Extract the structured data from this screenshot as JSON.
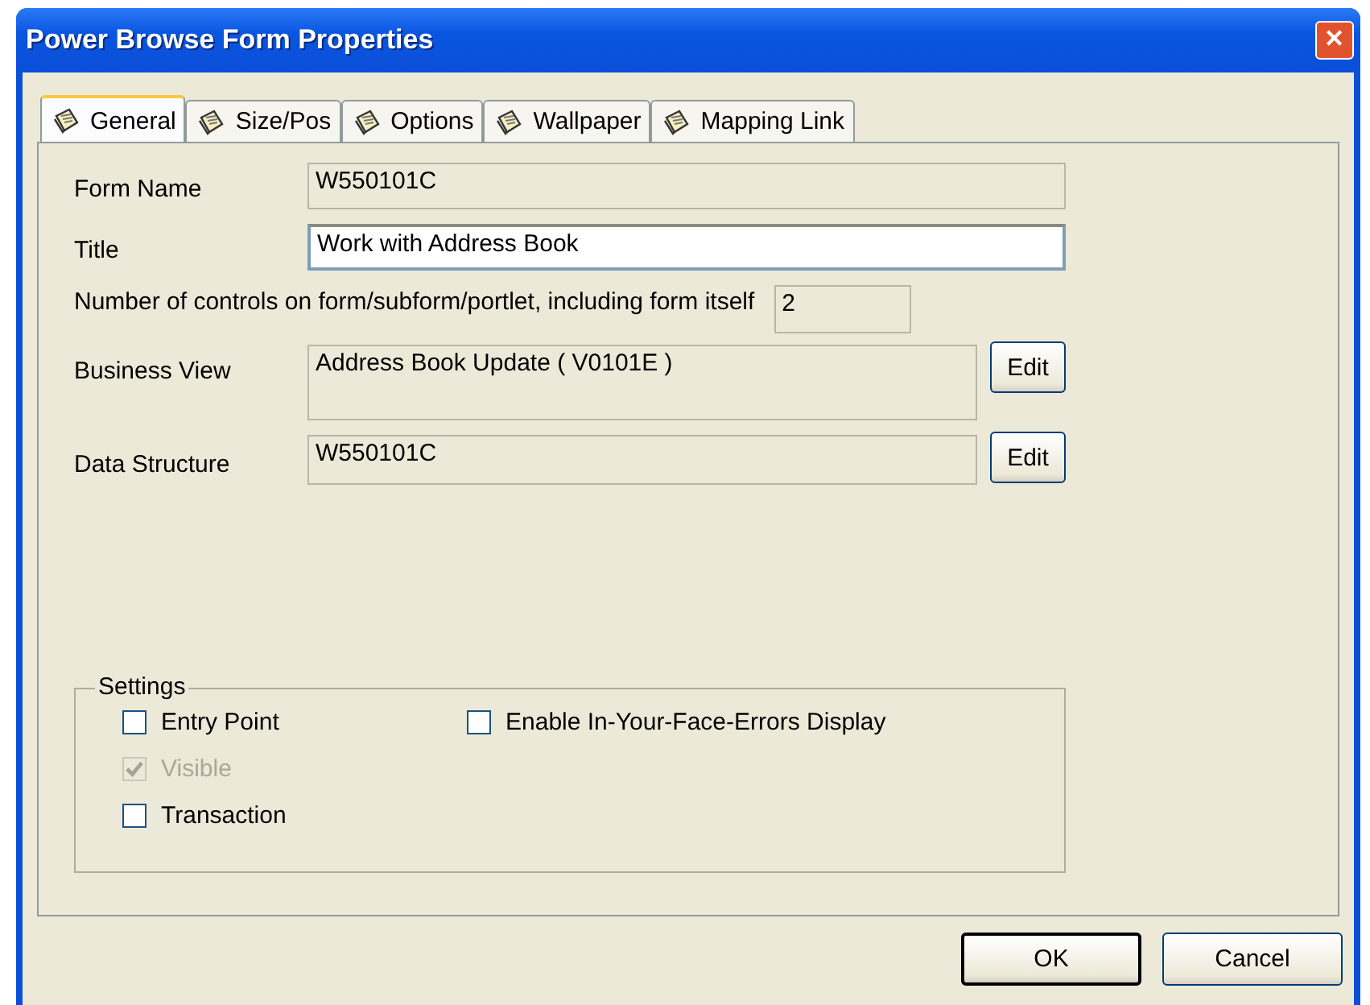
{
  "window": {
    "title": "Power Browse Form Properties",
    "close": "✕"
  },
  "tabs": [
    {
      "label": "General",
      "selected": true
    },
    {
      "label": "Size/Pos",
      "selected": false
    },
    {
      "label": "Options",
      "selected": false
    },
    {
      "label": "Wallpaper",
      "selected": false
    },
    {
      "label": "Mapping Link",
      "selected": false
    }
  ],
  "fields": [
    {
      "kind": "line",
      "label": "Form Name",
      "value": "W550101C",
      "readonly": true
    },
    {
      "kind": "line",
      "label": "Title",
      "value": "Work with Address Book",
      "readonly": false
    },
    {
      "kind": "count",
      "label": "Number of controls on form/subform/portlet, including form itself",
      "value": "2",
      "readonly": true
    },
    {
      "kind": "multi",
      "label": "Business View",
      "value": "Address Book Update ( V0101E )",
      "readonly": true,
      "button": "Edit"
    },
    {
      "kind": "button",
      "label": "Data Structure",
      "value": "W550101C",
      "readonly": true,
      "button": "Edit"
    }
  ],
  "settings": {
    "title": "Settings",
    "items": [
      {
        "label": "Entry Point",
        "checked": false,
        "disabled": false
      },
      {
        "label": "Enable In-Your-Face-Errors Display",
        "checked": false,
        "disabled": false
      },
      {
        "label": "Visible",
        "checked": true,
        "disabled": true
      },
      {
        "label": "Transaction",
        "checked": false,
        "disabled": false
      }
    ]
  },
  "buttons": [
    {
      "label": "OK",
      "default": true
    },
    {
      "label": "Cancel",
      "default": false
    }
  ]
}
